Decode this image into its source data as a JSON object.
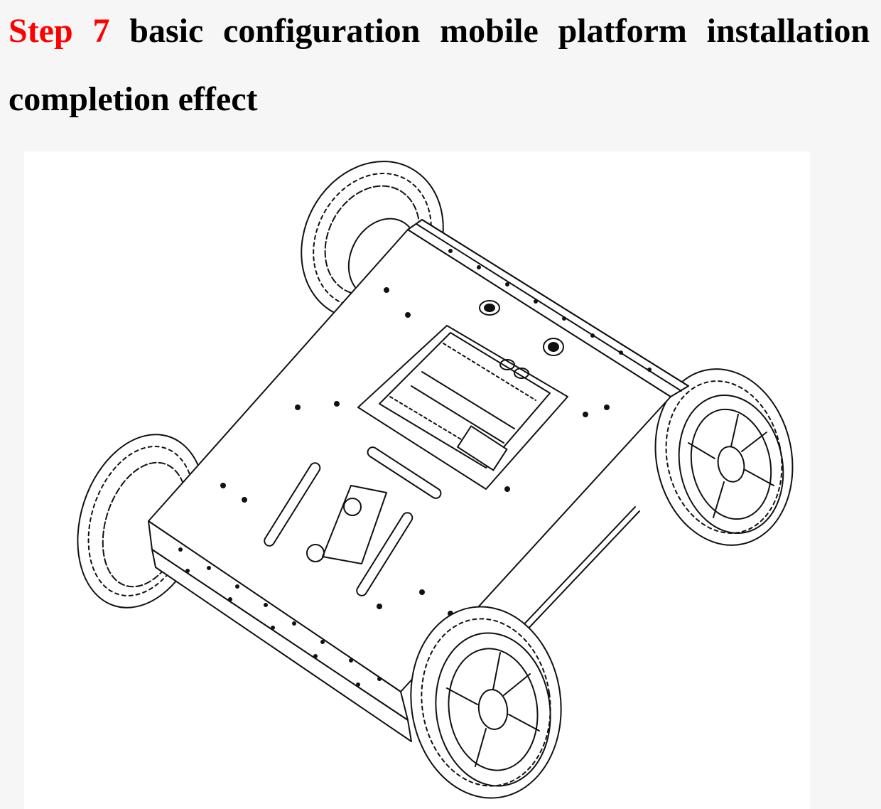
{
  "heading": {
    "step_label": "Step",
    "step_number": "7",
    "title": "basic configuration mobile platform installation completion effect"
  },
  "colors": {
    "step_color": "#ff0000",
    "text_color": "#000000",
    "page_background": "#f6f6f6",
    "figure_background": "#ffffff"
  }
}
